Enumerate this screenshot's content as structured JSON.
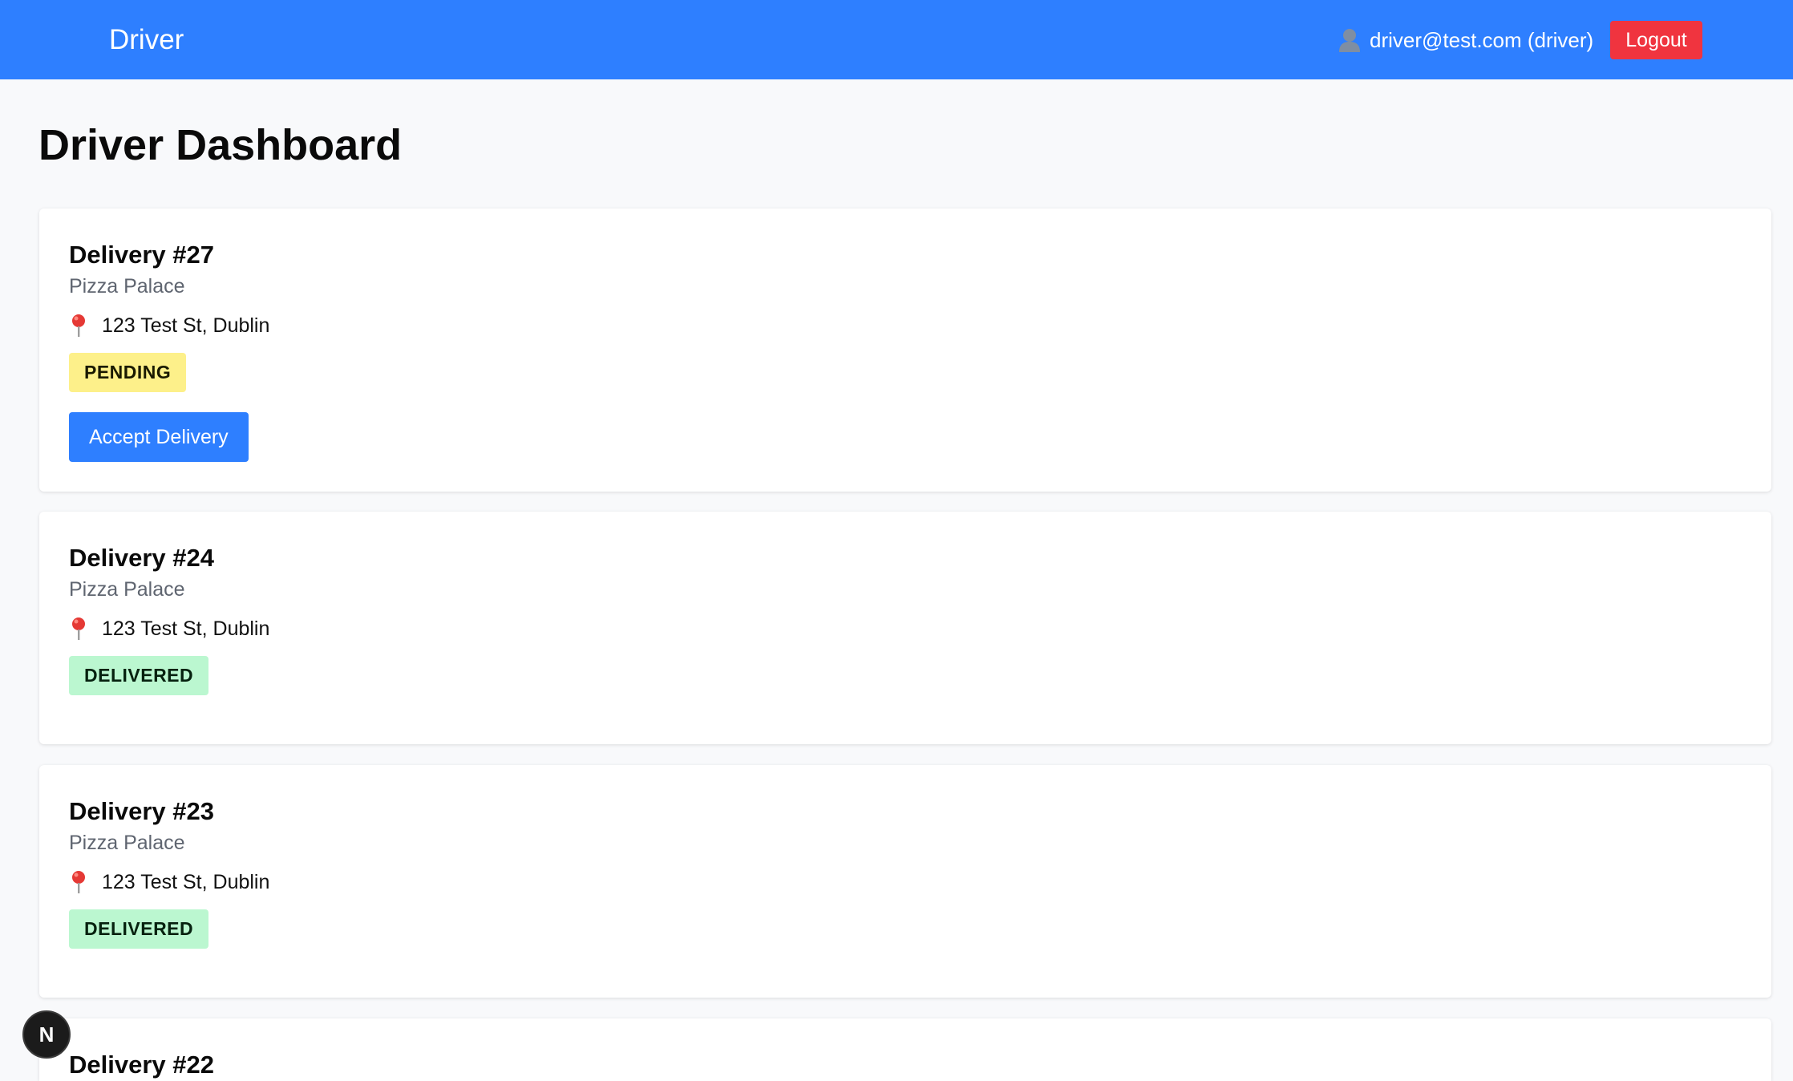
{
  "navbar": {
    "brand": "Driver",
    "user_label": "driver@test.com (driver)",
    "user_icon": "user-icon",
    "logout_label": "Logout",
    "bg_color": "#2e7fff",
    "logout_color": "#f0343f"
  },
  "page": {
    "title": "Driver Dashboard"
  },
  "deliveries": [
    {
      "title": "Delivery #27",
      "restaurant": "Pizza Palace",
      "address": "123 Test St, Dublin",
      "status": "PENDING",
      "action_label": "Accept Delivery"
    },
    {
      "title": "Delivery #24",
      "restaurant": "Pizza Palace",
      "address": "123 Test St, Dublin",
      "status": "DELIVERED"
    },
    {
      "title": "Delivery #23",
      "restaurant": "Pizza Palace",
      "address": "123 Test St, Dublin",
      "status": "DELIVERED"
    },
    {
      "title": "Delivery #22"
    }
  ],
  "dev_indicator": {
    "label": "N"
  },
  "colors": {
    "pending_badge": "#fdf08a",
    "delivered_badge": "#bbf7d0",
    "primary_button": "#2e7fff"
  }
}
